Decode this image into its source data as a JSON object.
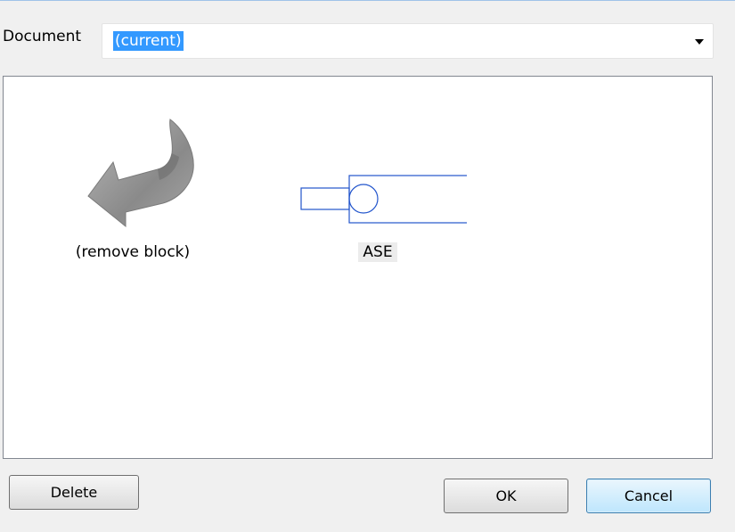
{
  "document": {
    "label": "Document",
    "selected_value": "(current)"
  },
  "gallery": {
    "items": [
      {
        "label": "(remove block)",
        "icon": "remove-block-arrow-icon"
      },
      {
        "label": "ASE",
        "icon": "ase-block-thumbnail"
      }
    ]
  },
  "buttons": {
    "delete": "Delete",
    "ok": "OK",
    "cancel": "Cancel"
  },
  "colors": {
    "selection": "#3399ff",
    "block_preview_stroke": "#2255cc",
    "arrow_gray": "#8c8c8c"
  }
}
